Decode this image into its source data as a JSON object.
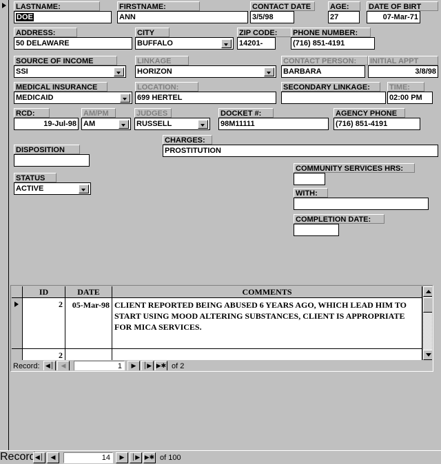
{
  "form": {
    "record_selector_icon": "record-selector-arrow",
    "fields": [
      {
        "key": "lastname",
        "label": "LASTNAME:",
        "value": "DOE",
        "type": "text",
        "dim": false,
        "selected": true
      },
      {
        "key": "firstname",
        "label": "FIRSTNAME:",
        "value": "ANN",
        "type": "text",
        "dim": false
      },
      {
        "key": "contact_date",
        "label": "CONTACT DATE",
        "value": "3/5/98",
        "type": "text",
        "dim": false
      },
      {
        "key": "age",
        "label": "AGE:",
        "value": "27",
        "type": "text",
        "dim": false
      },
      {
        "key": "date_of_birth",
        "label": "DATE OF BIRT",
        "value": "07-Mar-71",
        "type": "text",
        "dim": false,
        "align": "right"
      },
      {
        "key": "address",
        "label": "ADDRESS:",
        "value": "50 DELAWARE",
        "type": "text",
        "dim": false
      },
      {
        "key": "city",
        "label": "CITY",
        "value": "BUFFALO",
        "type": "combo",
        "dim": false
      },
      {
        "key": "zip_code",
        "label": "ZIP CODE:",
        "value": "14201-",
        "type": "text",
        "dim": false
      },
      {
        "key": "phone_number",
        "label": "PHONE NUMBER:",
        "value": "(716) 851-4191",
        "type": "text",
        "dim": false
      },
      {
        "key": "source_of_income",
        "label": "SOURCE OF INCOME",
        "value": "SSI",
        "type": "combo",
        "dim": false
      },
      {
        "key": "linkage",
        "label": "LINKAGE",
        "value": "HORIZON",
        "type": "combo",
        "dim": true
      },
      {
        "key": "contact_person",
        "label": "CONTACT PERSON:",
        "value": "BARBARA",
        "type": "text",
        "dim": true
      },
      {
        "key": "initial_appt",
        "label": "INITIAL APPT",
        "value": "3/8/98",
        "type": "text",
        "dim": true,
        "align": "right"
      },
      {
        "key": "medical_insurance",
        "label": "MEDICAL INSURANCE",
        "value": "MEDICAID",
        "type": "combo",
        "dim": false
      },
      {
        "key": "location",
        "label": "LOCATION:",
        "value": "699 HERTEL",
        "type": "text",
        "dim": true
      },
      {
        "key": "secondary_linkage",
        "label": "SECONDARY LINKAGE:",
        "value": "",
        "type": "text",
        "dim": false
      },
      {
        "key": "time",
        "label": "TIME:",
        "value": "02:00 PM",
        "type": "text",
        "dim": true
      },
      {
        "key": "rcd",
        "label": "RCD:",
        "value": "19-Jul-98",
        "type": "text",
        "dim": false,
        "align": "right"
      },
      {
        "key": "am_pm",
        "label": "AM/PM",
        "value": "AM",
        "type": "combo",
        "dim": true
      },
      {
        "key": "judges",
        "label": "JUDGES",
        "value": "RUSSELL",
        "type": "combo",
        "dim": true
      },
      {
        "key": "docket_number",
        "label": "DOCKET #:",
        "value": "98M11111",
        "type": "text",
        "dim": false
      },
      {
        "key": "agency_phone",
        "label": "AGENCY PHONE",
        "value": "(716) 851-4191",
        "type": "text",
        "dim": false
      },
      {
        "key": "charges",
        "label": "CHARGES:",
        "value": "PROSTITUTION",
        "type": "text",
        "dim": false
      },
      {
        "key": "disposition",
        "label": "DISPOSITION",
        "value": "",
        "type": "text",
        "dim": false
      },
      {
        "key": "status",
        "label": "STATUS",
        "value": "ACTIVE",
        "type": "combo",
        "dim": false
      },
      {
        "key": "community_services_hrs",
        "label": "COMMUNITY SERVICES HRS:",
        "value": "",
        "type": "text",
        "dim": false
      },
      {
        "key": "with",
        "label": "WITH:",
        "value": "",
        "type": "text",
        "dim": false
      },
      {
        "key": "completion_date",
        "label": "COMPLETION DATE:",
        "value": "",
        "type": "text",
        "dim": false
      }
    ]
  },
  "subform": {
    "columns": [
      "ID",
      "DATE",
      "COMMENTS"
    ],
    "rows": [
      {
        "selected": true,
        "id": "2",
        "date": "05-Mar-98",
        "comments": "CLIENT REPORTED BEING ABUSED 6 YEARS AGO, WHICH LEAD HIM TO START USING MOOD ALTERING SUBSTANCES, CLIENT IS APPROPRIATE FOR MICA SERVICES."
      },
      {
        "selected": false,
        "id": "2",
        "date": "",
        "comments": ""
      }
    ],
    "navigator": {
      "label": "Record:",
      "current": "1",
      "of_label": "of  2",
      "first_icon": "first-record-icon",
      "prev_icon": "previous-record-icon",
      "next_icon": "next-record-icon",
      "last_icon": "last-record-icon",
      "new_icon": "new-record-icon",
      "prev_disabled": true
    },
    "scrollbar": {
      "up_icon": "scroll-up-icon",
      "down_icon": "scroll-down-icon"
    }
  },
  "form_navigator": {
    "label": "Record:",
    "current": "14",
    "of_label": "of  100",
    "first_icon": "first-record-icon",
    "prev_icon": "previous-record-icon",
    "next_icon": "next-record-icon",
    "last_icon": "last-record-icon",
    "new_icon": "new-record-icon"
  },
  "glyphs": {
    "first": "◀│",
    "prev": "◀",
    "next": "▶",
    "last": "│▶",
    "new": "▶✱"
  },
  "colors": {
    "face": "#c0c0c0",
    "field_bg": "#ffffff",
    "text": "#000000",
    "dim_text": "#808080",
    "shadow": "#808080",
    "highlight": "#ffffff"
  }
}
